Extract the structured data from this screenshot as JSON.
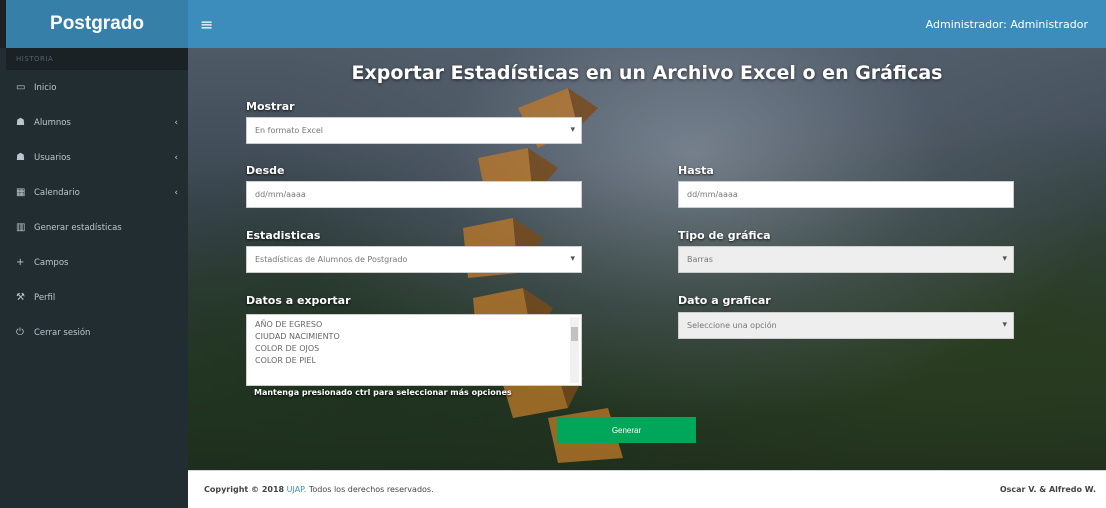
{
  "app": {
    "logo": "Postgrado"
  },
  "header": {
    "menu_icon": "hamburger-icon",
    "user": "Administrador: Administrador"
  },
  "sidebar": {
    "section": "HISTORIA",
    "items": [
      {
        "label": "Inicio",
        "icon": "monitor-icon",
        "has_arrow": false
      },
      {
        "label": "Alumnos",
        "icon": "users-icon",
        "has_arrow": true
      },
      {
        "label": "Usuarios",
        "icon": "users-icon",
        "has_arrow": true
      },
      {
        "label": "Calendario",
        "icon": "calendar-icon",
        "has_arrow": true
      },
      {
        "label": "Generar estadísticas",
        "icon": "bar-chart-icon",
        "has_arrow": false
      },
      {
        "label": "Campos",
        "icon": "plus-icon",
        "has_arrow": false
      },
      {
        "label": "Perfil",
        "icon": "wrench-icon",
        "has_arrow": false
      },
      {
        "label": "Cerrar sesión",
        "icon": "power-icon",
        "has_arrow": false
      }
    ]
  },
  "main": {
    "title": "Exportar Estadísticas en un Archivo Excel o en Gráficas",
    "mostrar": {
      "label": "Mostrar",
      "value": "En formato Excel"
    },
    "desde": {
      "label": "Desde",
      "placeholder": "dd/mm/aaaa"
    },
    "hasta": {
      "label": "Hasta",
      "placeholder": "dd/mm/aaaa"
    },
    "estadisticas": {
      "label": "Estadisticas",
      "value": "Estadísticas de Alumnos de Postgrado"
    },
    "tipo_grafica": {
      "label": "Tipo de gráfica",
      "value": "Barras"
    },
    "datos_exportar": {
      "label": "Datos a exportar",
      "options": [
        "AÑO DE EGRESO",
        "CIUDAD NACIMIENTO",
        "COLOR DE OJOS",
        "COLOR DE PIEL"
      ]
    },
    "dato_graficar": {
      "label": "Dato a graficar",
      "value": "Seleccione una opción"
    },
    "hint": "Mantenga presionado ctrl para seleccionar más opciones",
    "generate_button": "Generar"
  },
  "footer": {
    "copyright_prefix": "Copyright © 2018",
    "brand": "UJAP.",
    "rights": "Todos los derechos reservados.",
    "authors": "Oscar V. & Alfredo W."
  }
}
